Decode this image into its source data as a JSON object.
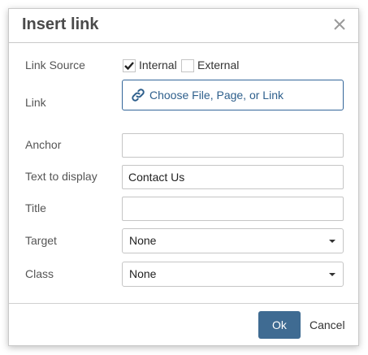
{
  "dialog": {
    "title": "Insert link",
    "close_icon": "close-icon"
  },
  "form": {
    "link_source": {
      "label": "Link Source",
      "options": [
        {
          "label": "Internal",
          "checked": true
        },
        {
          "label": "External",
          "checked": false
        }
      ]
    },
    "link": {
      "label": "Link",
      "chooser_text": "Choose File, Page, or Link",
      "icon": "link-icon"
    },
    "anchor": {
      "label": "Anchor",
      "value": ""
    },
    "text_to_display": {
      "label": "Text to display",
      "value": "Contact Us"
    },
    "title": {
      "label": "Title",
      "value": ""
    },
    "target": {
      "label": "Target",
      "value": "None"
    },
    "class": {
      "label": "Class",
      "value": "None"
    }
  },
  "footer": {
    "ok_label": "Ok",
    "cancel_label": "Cancel"
  },
  "colors": {
    "primary_button": "#3f6b92",
    "link_text": "#2e5f8c",
    "border": "#c5c5c5"
  }
}
